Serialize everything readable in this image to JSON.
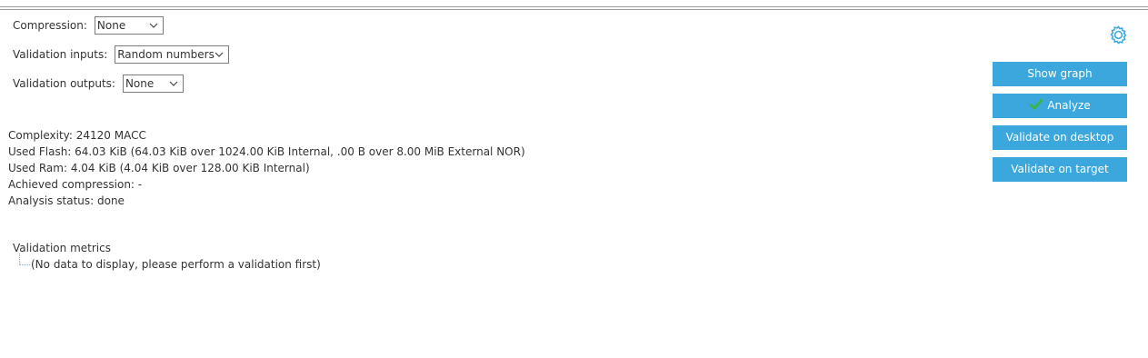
{
  "settings": {
    "compression": {
      "label": "Compression:",
      "value": "None"
    },
    "validation_inputs": {
      "label": "Validation inputs:",
      "value": "Random numbers"
    },
    "validation_outputs": {
      "label": "Validation outputs:",
      "value": "None"
    }
  },
  "info": {
    "complexity": "Complexity:  24120 MACC",
    "used_flash": "Used Flash: 64.03 KiB (64.03 KiB over 1024.00 KiB Internal, .00 B over 8.00 MiB External NOR)",
    "used_ram": "Used Ram: 4.04 KiB (4.04 KiB over 128.00 KiB Internal)",
    "achieved_compression": "Achieved compression: -",
    "analysis_status": "Analysis status: done"
  },
  "metrics": {
    "title": "Validation metrics",
    "empty_message": "(No data to display, please perform a validation first)"
  },
  "buttons": {
    "show_graph": "Show graph",
    "analyze": "Analyze",
    "validate_desktop": "Validate on desktop",
    "validate_target": "Validate on target"
  },
  "icons": {
    "settings": "gear-icon",
    "analyze": "check-icon",
    "dropdown": "chevron-down-icon"
  },
  "colors": {
    "button_bg": "#3ca7dc",
    "button_text": "#ffffff",
    "gear": "#3ca7dc",
    "check": "#3db43d"
  }
}
